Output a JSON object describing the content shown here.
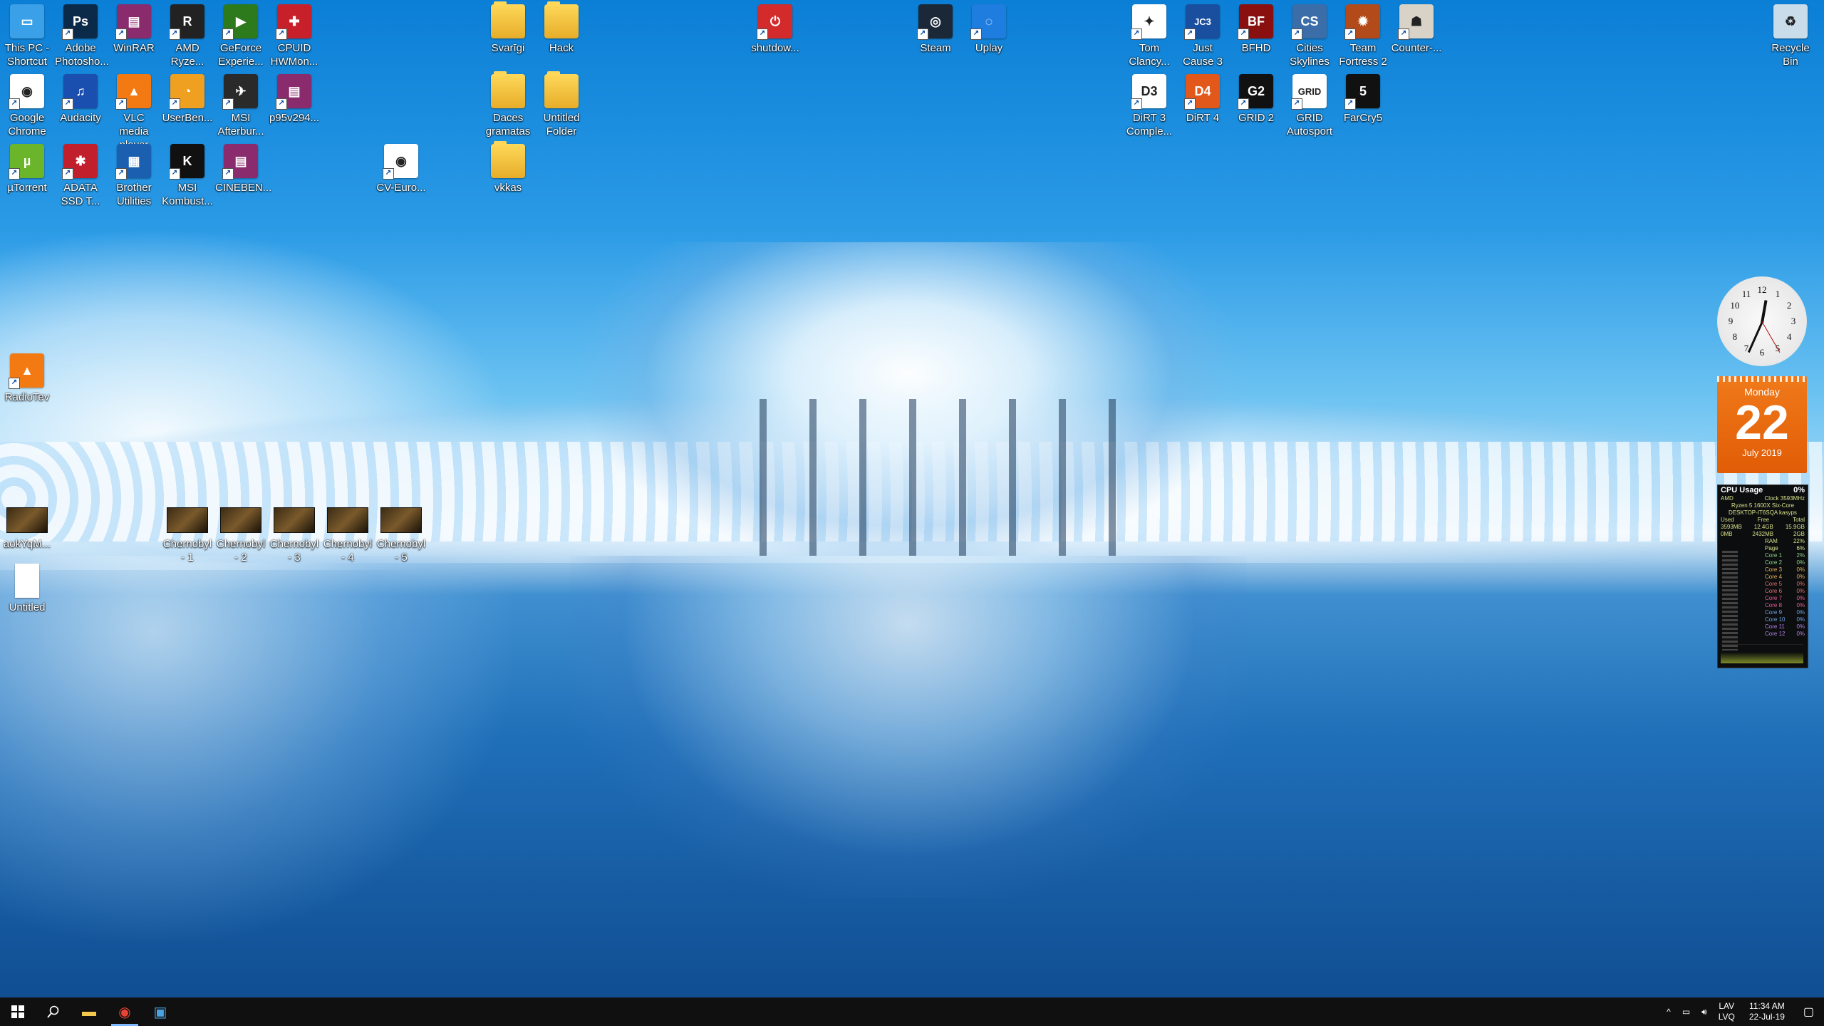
{
  "desktop": {
    "icons": [
      {
        "id": "this-pc",
        "label": "This PC - Shortcut",
        "color": "#3aa0e8",
        "glyph": "▭"
      },
      {
        "id": "photoshop",
        "label": "Adobe Photosho...",
        "color": "#0b2a4a",
        "glyph": "Ps"
      },
      {
        "id": "winrar",
        "label": "WinRAR",
        "color": "#8a2b6e",
        "glyph": "▤"
      },
      {
        "id": "amd-ryzen",
        "label": "AMD Ryze...",
        "color": "#222222",
        "glyph": "R"
      },
      {
        "id": "geforce",
        "label": "GeForce Experie...",
        "color": "#2d7a1c",
        "glyph": "▶"
      },
      {
        "id": "cpuid",
        "label": "CPUID HWMon...",
        "color": "#c8202a",
        "glyph": "✚"
      },
      {
        "id": "chrome",
        "label": "Google Chrome",
        "color": "#ffffff",
        "glyph": "◉"
      },
      {
        "id": "audacity",
        "label": "Audacity",
        "color": "#1a4fb0",
        "glyph": "♫"
      },
      {
        "id": "vlc",
        "label": "VLC media player",
        "color": "#f37a12",
        "glyph": "▲"
      },
      {
        "id": "userbench",
        "label": "UserBen...",
        "color": "#f0a020",
        "glyph": "◔"
      },
      {
        "id": "msi-afterburner",
        "label": "MSI Afterbur...",
        "color": "#2a2a2a",
        "glyph": "✈"
      },
      {
        "id": "p95",
        "label": "p95v294...",
        "color": "#8a2b6e",
        "glyph": "▤"
      },
      {
        "id": "utorrent",
        "label": "µTorrent",
        "color": "#6bb52a",
        "glyph": "µ"
      },
      {
        "id": "adata",
        "label": "ADATA SSD T...",
        "color": "#c21f2c",
        "glyph": "✱"
      },
      {
        "id": "brother",
        "label": "Brother Utilities",
        "color": "#1b5fb0",
        "glyph": "▦"
      },
      {
        "id": "msi-kombustor",
        "label": "MSI Kombust...",
        "color": "#111111",
        "glyph": "K"
      },
      {
        "id": "cinebench",
        "label": "CINEBEN...",
        "color": "#8a2b6e",
        "glyph": "▤"
      },
      {
        "id": "cv-euro",
        "label": "CV-Euro...",
        "color": "#ffffff",
        "glyph": "◉"
      },
      {
        "id": "svarigi",
        "label": "Svarīgi",
        "color": "#f2c94c",
        "glyph": ""
      },
      {
        "id": "hack",
        "label": "Hack",
        "color": "#f2c94c",
        "glyph": ""
      },
      {
        "id": "daces",
        "label": "Daces gramatas",
        "color": "#f2c94c",
        "glyph": ""
      },
      {
        "id": "untitled-folder",
        "label": "Untitled Folder",
        "color": "#f2c94c",
        "glyph": ""
      },
      {
        "id": "vkkas",
        "label": "vkkas",
        "color": "#f2c94c",
        "glyph": ""
      },
      {
        "id": "shutdown",
        "label": "shutdow...",
        "color": "#d32b2b",
        "glyph": "⏻"
      },
      {
        "id": "steam",
        "label": "Steam",
        "color": "#1b2838",
        "glyph": "◎"
      },
      {
        "id": "uplay",
        "label": "Uplay",
        "color": "#1f7de0",
        "glyph": "◌"
      },
      {
        "id": "tom-clancy",
        "label": "Tom Clancy...",
        "color": "#ffffff",
        "glyph": "✦"
      },
      {
        "id": "just-cause",
        "label": "Just Cause 3",
        "color": "#1a4fa0",
        "glyph": "JC3"
      },
      {
        "id": "bfhd",
        "label": "BFHD",
        "color": "#8a1010",
        "glyph": "BF"
      },
      {
        "id": "cities",
        "label": "Cities Skylines",
        "color": "#3b6ea8",
        "glyph": "CS"
      },
      {
        "id": "tf2",
        "label": "Team Fortress 2",
        "color": "#b34a1a",
        "glyph": "✹"
      },
      {
        "id": "counter",
        "label": "Counter-...",
        "color": "#d9d3c7",
        "glyph": "☗"
      },
      {
        "id": "dirt3",
        "label": "DiRT 3 Comple...",
        "color": "#ffffff",
        "glyph": "D3"
      },
      {
        "id": "dirt4",
        "label": "DiRT 4",
        "color": "#e2581a",
        "glyph": "D4"
      },
      {
        "id": "grid2",
        "label": "GRID 2",
        "color": "#111111",
        "glyph": "G2"
      },
      {
        "id": "grid-auto",
        "label": "GRID Autosport",
        "color": "#ffffff",
        "glyph": "GRID"
      },
      {
        "id": "farcry5",
        "label": "FarCry5",
        "color": "#111111",
        "glyph": "5"
      },
      {
        "id": "recycle",
        "label": "Recycle Bin",
        "color": "#c8dcea",
        "glyph": "♻"
      },
      {
        "id": "radio",
        "label": "RadioTev",
        "color": "#f37a12",
        "glyph": "▲"
      },
      {
        "id": "aok",
        "label": "aokYqM...",
        "color": "#444444",
        "glyph": ""
      },
      {
        "id": "chernobyl1",
        "label": "Chernobyl - 1",
        "color": "#6a4a22",
        "glyph": ""
      },
      {
        "id": "chernobyl2",
        "label": "Chernobyl - 2",
        "color": "#6a4a22",
        "glyph": ""
      },
      {
        "id": "chernobyl3",
        "label": "Chernobyl - 3",
        "color": "#6a4a22",
        "glyph": ""
      },
      {
        "id": "chernobyl4",
        "label": "Chernobyl - 4",
        "color": "#6a4a22",
        "glyph": ""
      },
      {
        "id": "chernobyl5",
        "label": "Chernobyl - 5",
        "color": "#6a4a22",
        "glyph": ""
      },
      {
        "id": "untitled-file",
        "label": "Untitled",
        "color": "#ffffff",
        "glyph": ""
      }
    ]
  },
  "gadgets": {
    "clock": {
      "numbers": [
        "12",
        "1",
        "2",
        "3",
        "4",
        "5",
        "6",
        "7",
        "8",
        "9",
        "10",
        "11"
      ]
    },
    "calendar": {
      "weekday": "Monday",
      "day": "22",
      "month_year": "July 2019"
    },
    "cpu": {
      "title": "CPU Usage",
      "percent": "0%",
      "vendor": "AMD",
      "clock": "Clock 3593MHz",
      "model": "Ryzen 5 1600X Six-Core",
      "host": "DESKTOP-IT6SQA kasyps",
      "headers": [
        "Used",
        "Free",
        "Total"
      ],
      "mem_row": [
        "3593MB",
        "12.4GB",
        "15.9GB"
      ],
      "page_row": [
        "0MB",
        "2432MB",
        "2GB"
      ],
      "rows": [
        {
          "label": "RAM",
          "value": "22%"
        },
        {
          "label": "Page",
          "value": "6%"
        },
        {
          "label": "Core 1",
          "value": "2%"
        },
        {
          "label": "Core 2",
          "value": "0%"
        },
        {
          "label": "Core 3",
          "value": "0%"
        },
        {
          "label": "Core 4",
          "value": "0%"
        },
        {
          "label": "Core 5",
          "value": "0%"
        },
        {
          "label": "Core 6",
          "value": "0%"
        },
        {
          "label": "Core 7",
          "value": "0%"
        },
        {
          "label": "Core 8",
          "value": "0%"
        },
        {
          "label": "Core 9",
          "value": "0%"
        },
        {
          "label": "Core 10",
          "value": "0%"
        },
        {
          "label": "Core 11",
          "value": "0%"
        },
        {
          "label": "Core 12",
          "value": "0%"
        }
      ]
    }
  },
  "taskbar": {
    "start_icon": "windows-start-icon",
    "search_icon": "search-icon",
    "pinned": [
      {
        "id": "explorer",
        "name": "file-explorer-icon",
        "glyph": "▬",
        "color": "#f2c94c",
        "active": false
      },
      {
        "id": "chrome",
        "name": "chrome-icon",
        "glyph": "◉",
        "color": "#e94335",
        "active": true
      },
      {
        "id": "app",
        "name": "app-icon",
        "glyph": "▣",
        "color": "#4aa3df",
        "active": false
      }
    ],
    "tray": {
      "chevron": "^",
      "lang_top": "LAV",
      "lang_bottom": "LVQ",
      "time": "11:34 AM",
      "date": "22-Jul-19"
    }
  }
}
